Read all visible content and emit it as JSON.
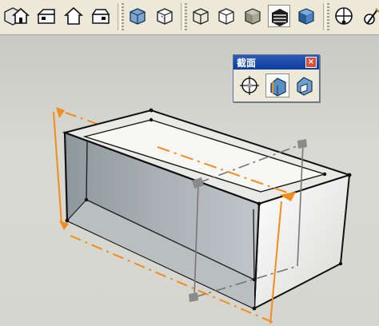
{
  "toolbar": {
    "buttons": [
      {
        "icon": "iso-view-icon"
      },
      {
        "icon": "home-front-icon"
      },
      {
        "icon": "house-side-icon"
      },
      {
        "icon": "house-outline-icon"
      },
      {
        "icon": "house-back-icon"
      },
      {
        "icon": "xray-cube-icon"
      },
      {
        "icon": "back-edges-cube-icon"
      },
      {
        "icon": "wireframe-cube-icon"
      },
      {
        "icon": "hidden-line-cube-icon"
      },
      {
        "icon": "shaded-cube-icon"
      },
      {
        "icon": "shaded-textures-cube-icon",
        "active": true
      },
      {
        "icon": "monochrome-cube-icon"
      },
      {
        "icon": "position-camera-icon"
      },
      {
        "icon": "walk-icon"
      }
    ]
  },
  "section_panel": {
    "title": "截面",
    "close_label": "×",
    "buttons": [
      {
        "icon": "section-plane-icon"
      },
      {
        "icon": "display-section-planes-icon",
        "active": true
      },
      {
        "icon": "display-section-cuts-icon"
      }
    ]
  },
  "colors": {
    "section_plane": "#f28c1c",
    "selected_plane": "#7a7a7a",
    "box_inner": "#9aa2a6",
    "box_light": "#f0f0f0"
  }
}
